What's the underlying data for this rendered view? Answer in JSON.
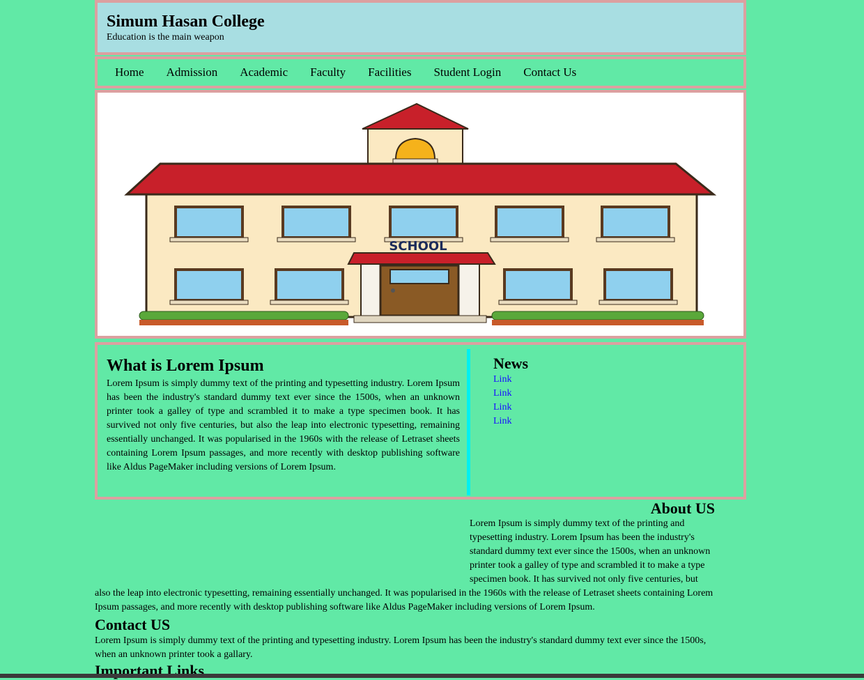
{
  "header": {
    "title": "Simum Hasan College",
    "tagline": "Education is the main weapon"
  },
  "nav": {
    "items": [
      "Home",
      "Admission",
      "Academic",
      "Faculty",
      "Facilities",
      "Student Login",
      "Contact Us"
    ]
  },
  "hero": {
    "sign_text": "SCHOOL",
    "colors": {
      "roof": "#c8202a",
      "wall": "#fbe9c2",
      "window": "#8fd0ee",
      "door": "#8a5a25",
      "bell": "#f5b21b"
    }
  },
  "main": {
    "heading": "What is Lorem Ipsum",
    "body": "Lorem Ipsum is simply dummy text of the printing and typesetting industry. Lorem Ipsum has been the industry's standard dummy text ever since the 1500s, when an unknown printer took a galley of type and scrambled it to make a type specimen book. It has survived not only five centuries, but also the leap into electronic typesetting, remaining essentially unchanged. It was popularised in the 1960s with the release of Letraset sheets containing Lorem Ipsum passages, and more recently with desktop publishing software like Aldus PageMaker including versions of Lorem Ipsum."
  },
  "news": {
    "heading": "News",
    "links": [
      "Link",
      "Link",
      "Link",
      "Link"
    ]
  },
  "about": {
    "heading": "About US",
    "body": "Lorem Ipsum is simply dummy text of the printing and typesetting industry. Lorem Ipsum has been the industry's standard dummy text ever since the 1500s, when an unknown printer took a galley of type and scrambled it to make a type specimen book. It has survived not only five centuries, but also the leap into electronic typesetting, remaining essentially unchanged. It was popularised in the 1960s with the release of Letraset sheets containing Lorem Ipsum passages, and more recently with desktop publishing software like Aldus PageMaker including versions of Lorem Ipsum."
  },
  "contact": {
    "heading": "Contact US",
    "body": "Lorem Ipsum is simply dummy text of the printing and typesetting industry. Lorem Ipsum has been the industry's standard dummy text ever since the 1500s, when an unknown printer took a gallary."
  },
  "important": {
    "heading": "Important Links"
  },
  "colors": {
    "page_bg": "#61e9a6",
    "header_bg": "#a8dee2",
    "border": "#dca0a0",
    "divider": "#00f0f0",
    "link": "#1a0dff"
  }
}
